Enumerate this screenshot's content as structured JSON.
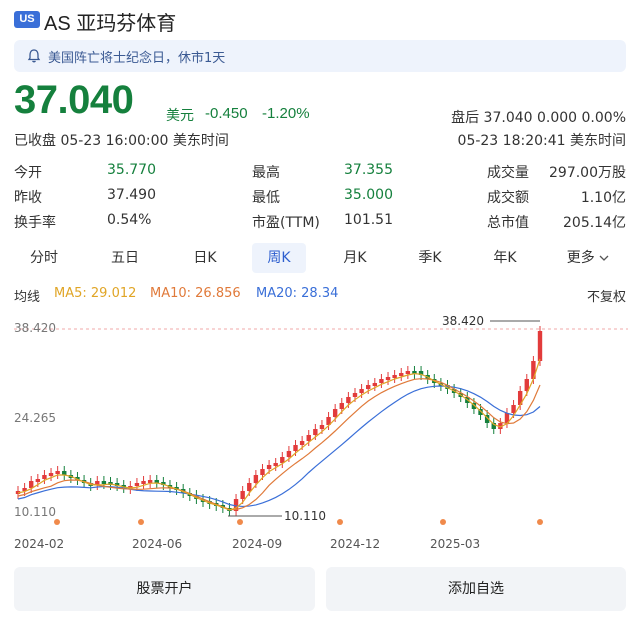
{
  "header": {
    "market_badge": "US",
    "title": "AS 亚玛芬体育"
  },
  "notice": {
    "icon": "bell-icon",
    "text": "美国阵亡将士纪念日，休市1天"
  },
  "quote": {
    "price": "37.040",
    "currency": "美元",
    "change": "-0.450",
    "change_pct": "-1.20%",
    "after_hours": "盘后 37.040 0.000 0.00%",
    "status": "已收盘 05-23 16:00:00 美东时间",
    "after_time": "05-23 18:20:41 美东时间",
    "color_down": "#15803d"
  },
  "stats": [
    {
      "label": "今开",
      "value": "35.770",
      "label2": "最高",
      "value2": "37.355",
      "label3": "成交量",
      "value3": "297.00万股"
    },
    {
      "label": "昨收",
      "value": "37.490",
      "label2": "最低",
      "value2": "35.000",
      "label3": "成交额",
      "value3": "1.10亿"
    },
    {
      "label": "换手率",
      "value": "0.54%",
      "label2": "市盈(TTM)",
      "value2": "101.51",
      "label3": "总市值",
      "value3": "205.14亿"
    }
  ],
  "tabs": [
    "分时",
    "五日",
    "日K",
    "周K",
    "月K",
    "季K",
    "年K",
    "更多"
  ],
  "active_tab": "周K",
  "ma": {
    "label": "均线",
    "ma5": "MA5: 29.012",
    "ma10": "MA10: 26.856",
    "ma20": "MA20: 28.34",
    "adjust": "不复权",
    "ma5_color": "#e0a526",
    "ma10_color": "#e07a3a",
    "ma20_color": "#3a6fd8"
  },
  "chart": {
    "y_labels": [
      "38.420",
      "24.265",
      "10.110"
    ],
    "x_labels": [
      "2024-02",
      "2024-06",
      "2024-09",
      "2024-12",
      "2025-03"
    ],
    "high_marker": "38.420",
    "low_marker": "10.110",
    "up_color": "#e23b3b",
    "down_color": "#15803d"
  },
  "buttons": {
    "open_account": "股票开户",
    "add_watch": "添加自选"
  }
}
